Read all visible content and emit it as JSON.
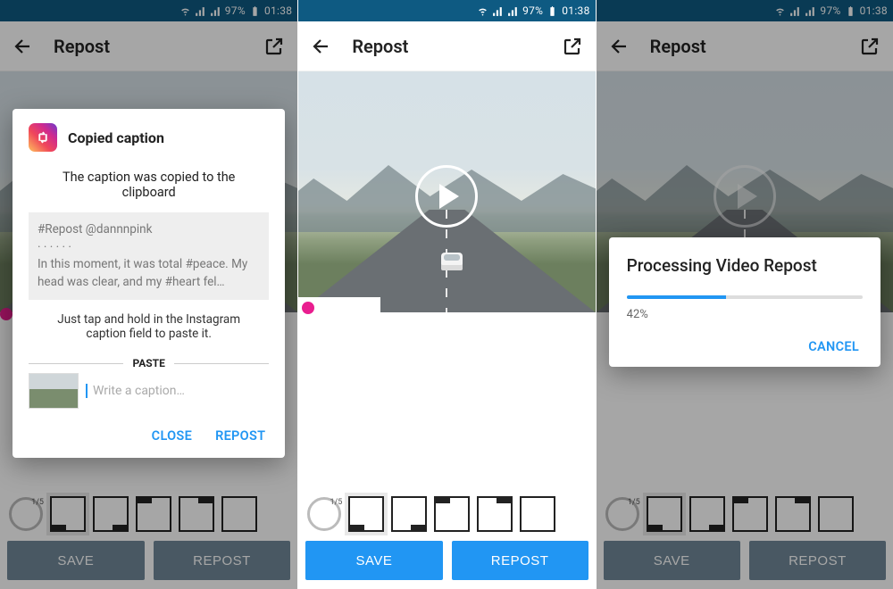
{
  "status": {
    "battery_pct": "97%",
    "time": "01:38"
  },
  "appbar": {
    "title": "Repost"
  },
  "bottom": {
    "circle_counter": "1/5",
    "save": "SAVE",
    "repost": "REPOST"
  },
  "dialog_copied": {
    "title": "Copied caption",
    "message": "The caption was copied to the clipboard",
    "caption_line1": "#Repost @dannnpink",
    "caption_dots": "· · · · · ·",
    "caption_line2": "In this moment, it was total #peace. My head was clear, and my #heart fel…",
    "hint": "Just tap and hold in the Instagram caption field to paste it.",
    "paste_label": "PASTE",
    "write_placeholder": "Write a caption…",
    "close": "CLOSE",
    "repost": "REPOST"
  },
  "dialog_processing": {
    "title": "Processing Video Repost",
    "percent_value": 42,
    "percent_text": "42%",
    "cancel": "CANCEL"
  }
}
